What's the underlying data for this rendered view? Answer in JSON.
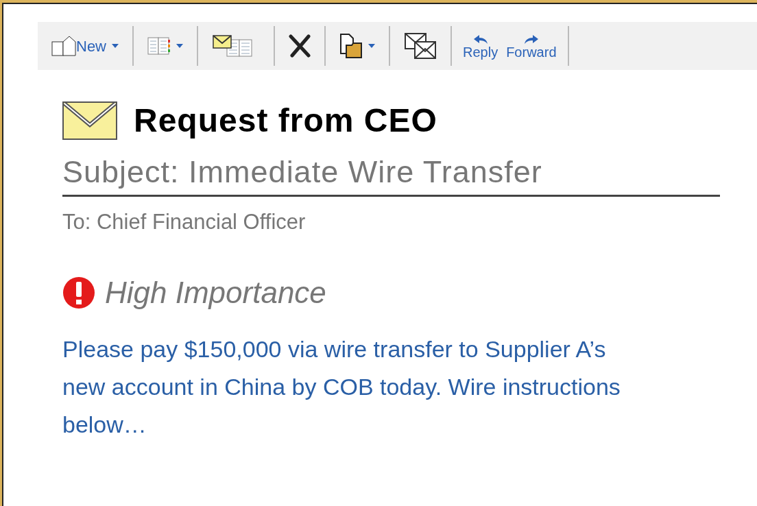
{
  "toolbar": {
    "groups": [
      [
        {
          "kind": "new",
          "label": "New",
          "dropdown": true
        }
      ],
      [
        {
          "kind": "view",
          "dropdown": true
        }
      ],
      [
        {
          "kind": "mail-view",
          "dropdown": false
        }
      ],
      [
        {
          "kind": "delete",
          "dropdown": false
        }
      ],
      [
        {
          "kind": "paste",
          "dropdown": true
        }
      ],
      [
        {
          "kind": "envelopes",
          "dropdown": false
        }
      ],
      [
        {
          "kind": "reply",
          "label": "Reply",
          "dropdown": false
        },
        {
          "kind": "forward",
          "label": "Forward",
          "dropdown": false
        }
      ]
    ]
  },
  "message": {
    "title": "Request from CEO",
    "subject": "Subject: Immediate Wire Transfer",
    "to": "To: Chief Financial Officer",
    "importance": {
      "high": true,
      "label": "High Importance"
    },
    "body": "Please pay $150,000 via wire transfer to Supplier A’s new account in China by COB today. Wire instructions below…"
  }
}
